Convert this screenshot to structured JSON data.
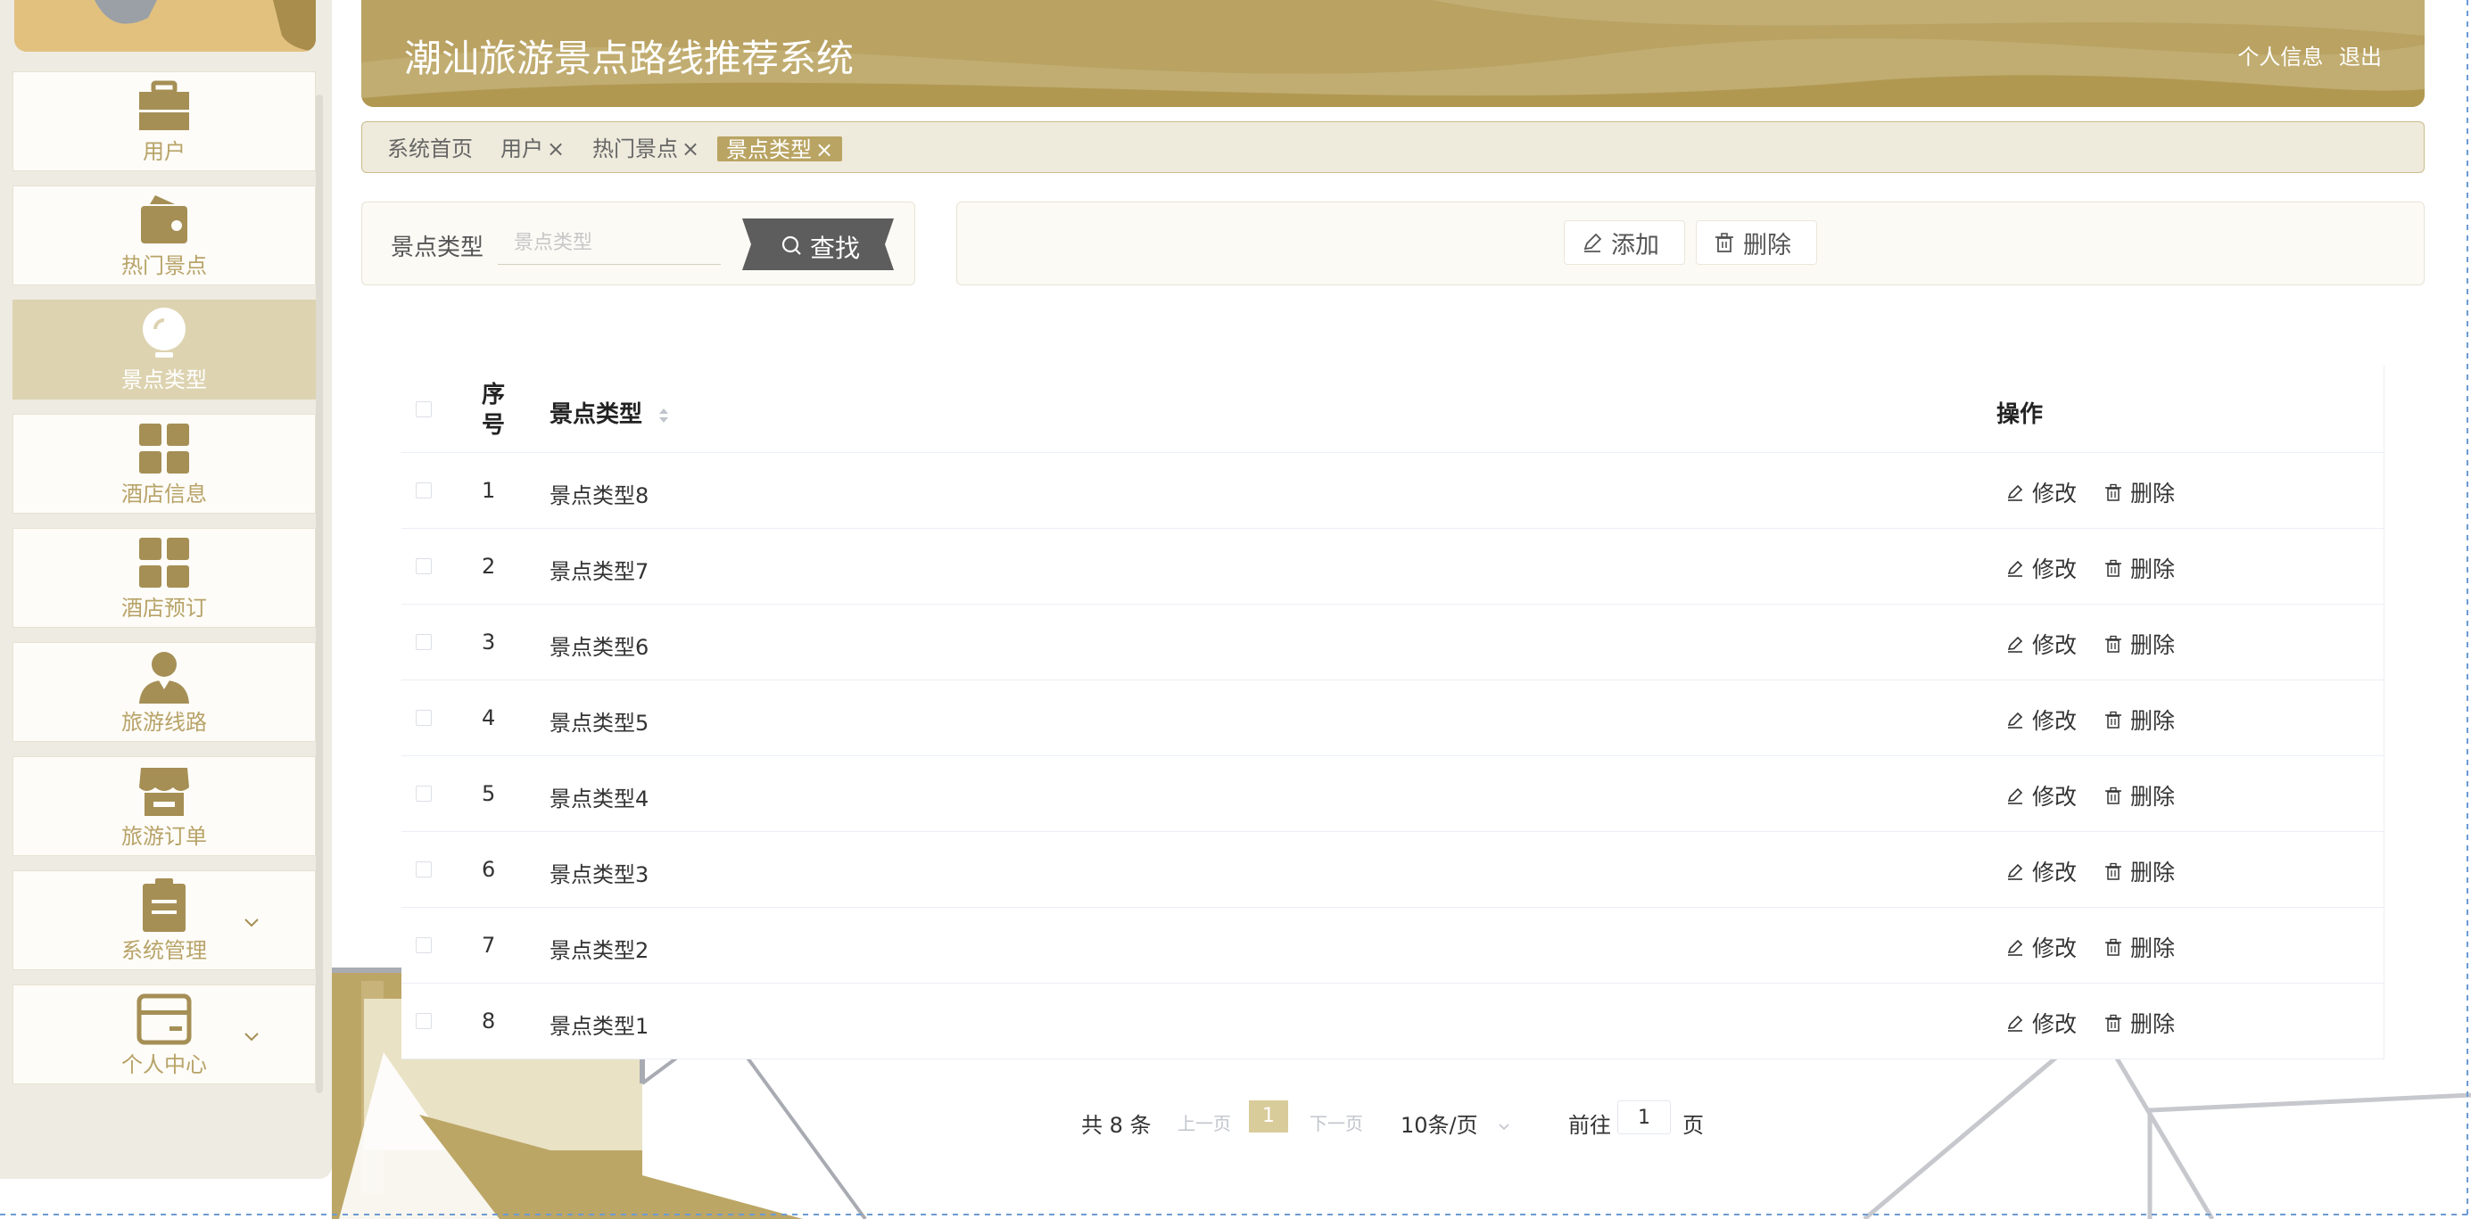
{
  "header": {
    "title": "潮汕旅游景点路线推荐系统",
    "profile_link": "个人信息",
    "logout_link": "退出"
  },
  "sidebar": {
    "items": [
      {
        "label": "用户",
        "icon": "briefcase-icon",
        "active": false
      },
      {
        "label": "热门景点",
        "icon": "wallet-icon",
        "active": false
      },
      {
        "label": "景点类型",
        "icon": "lightbulb-icon",
        "active": true
      },
      {
        "label": "酒店信息",
        "icon": "grid-icon",
        "active": false
      },
      {
        "label": "酒店预订",
        "icon": "grid-icon",
        "active": false
      },
      {
        "label": "旅游线路",
        "icon": "user-icon",
        "active": false
      },
      {
        "label": "旅游订单",
        "icon": "shop-icon",
        "active": false
      },
      {
        "label": "系统管理",
        "icon": "clipboard-icon",
        "active": false,
        "expandable": true
      },
      {
        "label": "个人中心",
        "icon": "card-icon",
        "active": false,
        "expandable": true
      }
    ]
  },
  "tabs": [
    {
      "label": "系统首页",
      "closable": false,
      "active": false
    },
    {
      "label": "用户",
      "closable": true,
      "active": false
    },
    {
      "label": "热门景点",
      "closable": true,
      "active": false
    },
    {
      "label": "景点类型",
      "closable": true,
      "active": true
    }
  ],
  "search": {
    "label": "景点类型",
    "placeholder": "景点类型",
    "value": "",
    "button_label": "查找"
  },
  "actions": {
    "add_label": "添加",
    "delete_label": "删除"
  },
  "table": {
    "columns": {
      "index": "序号",
      "type": "景点类型",
      "ops": "操作"
    },
    "edit_label": "修改",
    "delete_label": "删除",
    "rows": [
      {
        "index": "1",
        "type": "景点类型8"
      },
      {
        "index": "2",
        "type": "景点类型7"
      },
      {
        "index": "3",
        "type": "景点类型6"
      },
      {
        "index": "4",
        "type": "景点类型5"
      },
      {
        "index": "5",
        "type": "景点类型4"
      },
      {
        "index": "6",
        "type": "景点类型3"
      },
      {
        "index": "7",
        "type": "景点类型2"
      },
      {
        "index": "8",
        "type": "景点类型1"
      }
    ]
  },
  "pagination": {
    "total_text": "共 8 条",
    "prev_label": "上一页",
    "current_page": "1",
    "next_label": "下一页",
    "page_size": "10条/页",
    "goto_label": "前往",
    "goto_value": "1",
    "page_unit": "页"
  },
  "colors": {
    "accent": "#b9a463",
    "sidebar_bg": "#eeebe2",
    "sidebar_text": "#b8a368",
    "active_bg": "#ddd3b0",
    "search_button": "#5d5d5d"
  }
}
